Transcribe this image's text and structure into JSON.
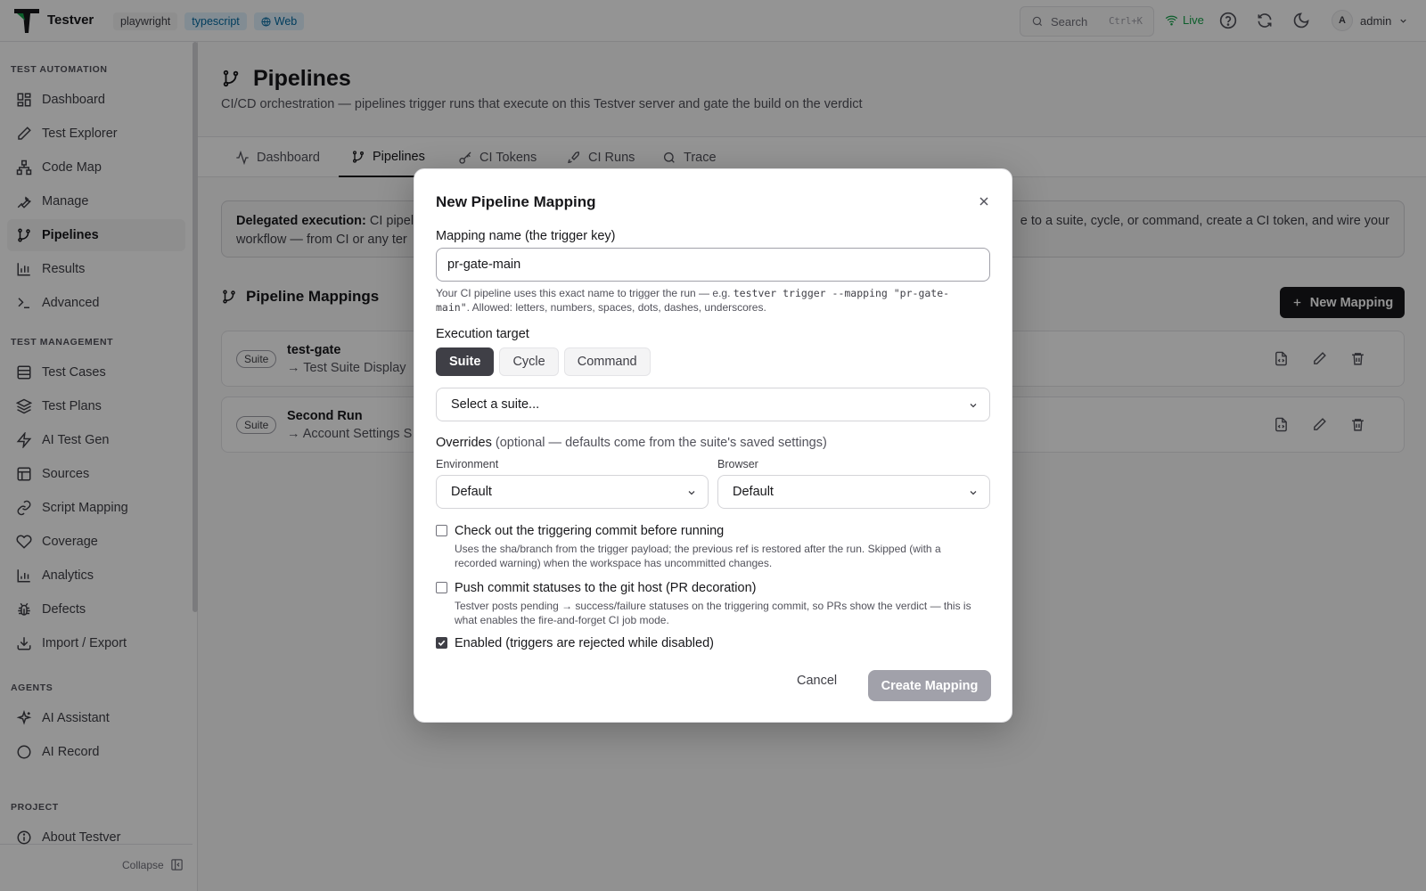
{
  "header": {
    "brand": "Testver",
    "chips": [
      "playwright",
      "typescript",
      "Web"
    ],
    "search_label": "Search",
    "search_shortcut": "Ctrl+K",
    "live_label": "Live",
    "user_initial": "A",
    "user_name": "admin"
  },
  "sidebar": {
    "sections": {
      "automation": "TEST AUTOMATION",
      "management": "TEST MANAGEMENT",
      "agents": "AGENTS",
      "project": "PROJECT"
    },
    "items": [
      {
        "label": "Dashboard",
        "icon": "dashboard-icon"
      },
      {
        "label": "Test Explorer",
        "icon": "pencil-icon"
      },
      {
        "label": "Code Map",
        "icon": "network-icon"
      },
      {
        "label": "Manage",
        "icon": "wrench-icon"
      },
      {
        "label": "Pipelines",
        "icon": "git-branch-icon"
      },
      {
        "label": "Results",
        "icon": "bar-chart-icon"
      },
      {
        "label": "Advanced",
        "icon": "terminal-icon"
      },
      {
        "label": "Test Cases",
        "icon": "list-icon"
      },
      {
        "label": "Test Plans",
        "icon": "layers-icon"
      },
      {
        "label": "AI Test Gen",
        "icon": "zap-icon"
      },
      {
        "label": "Sources",
        "icon": "database-icon"
      },
      {
        "label": "Script Mapping",
        "icon": "link-icon"
      },
      {
        "label": "Coverage",
        "icon": "heart-icon"
      },
      {
        "label": "Analytics",
        "icon": "bar-chart-icon"
      },
      {
        "label": "Defects",
        "icon": "bug-icon"
      },
      {
        "label": "Import / Export",
        "icon": "download-icon"
      },
      {
        "label": "AI Assistant",
        "icon": "sparkle-icon"
      },
      {
        "label": "AI Record",
        "icon": "circle-icon"
      },
      {
        "label": "About Testver",
        "icon": "info-icon"
      }
    ],
    "collapse_label": "Collapse"
  },
  "main": {
    "title": "Pipelines",
    "subtitle": "CI/CD orchestration — pipelines trigger runs that execute on this Testver server and gate the build on the verdict",
    "tabs": [
      "Dashboard",
      "Pipelines",
      "CI Tokens",
      "CI Runs",
      "Trace"
    ],
    "banner": {
      "strong": "Delegated execution:",
      "line1": " CI pipel",
      "line1_right": "e to a suite, cycle, or command, create a CI token, and wire your",
      "line2": "workflow — from CI or any ter"
    },
    "mappings_title": "Pipeline Mappings",
    "new_mapping_label": "New Mapping",
    "rows": [
      {
        "badge": "Suite",
        "name": "test-gate",
        "target": "→ Test Suite Display"
      },
      {
        "badge": "Suite",
        "name": "Second Run",
        "target": "→ Account Settings S"
      }
    ]
  },
  "modal": {
    "title": "New Pipeline Mapping",
    "name_label": "Mapping name (the trigger key)",
    "name_value": "pr-gate-main",
    "help_prefix": "Your CI pipeline uses this exact name to trigger the run — e.g. ",
    "help_code_1": "testver trigger --mapping \"pr-gate-",
    "help_code_2": "main\"",
    "help_suffix": ". Allowed: letters, numbers, spaces, dots, dashes, underscores.",
    "target_label": "Execution target",
    "targets": [
      "Suite",
      "Cycle",
      "Command"
    ],
    "suite_placeholder": "Select a suite...",
    "overrides_label": "Overrides",
    "overrides_hint": "(optional — defaults come from the suite's saved settings)",
    "env_label": "Environment",
    "env_value": "Default",
    "browser_label": "Browser",
    "browser_value": "Default",
    "checkout_title": "Check out the triggering commit before running",
    "checkout_desc": "Uses the sha/branch from the trigger payload; the previous ref is restored after the run. Skipped (with a recorded warning) when the workspace has uncommitted changes.",
    "push_title": "Push commit statuses to the git host (PR decoration)",
    "push_desc": "Testver posts pending → success/failure statuses on the triggering commit, so PRs show the verdict — this is what enables the fire-and-forget CI job mode.",
    "enabled_title": "Enabled (triggers are rejected while disabled)",
    "cancel_label": "Cancel",
    "create_label": "Create Mapping"
  }
}
